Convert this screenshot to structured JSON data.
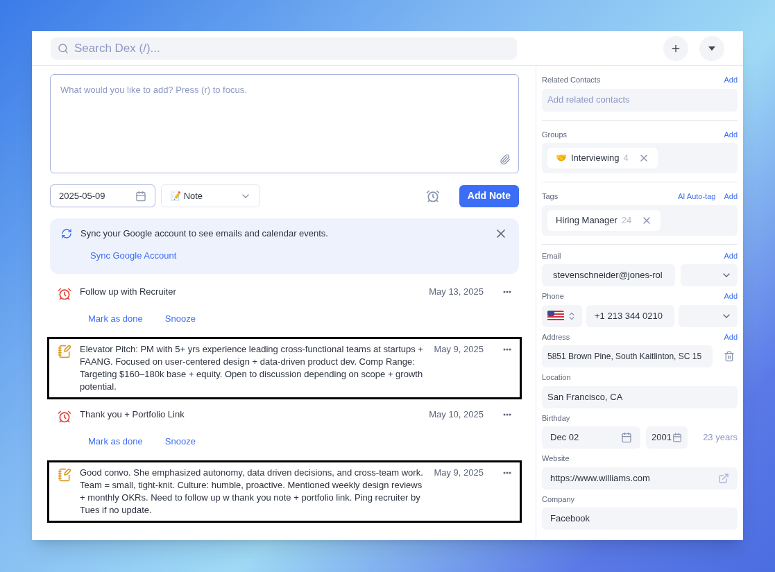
{
  "search": {
    "placeholder": "Search Dex (/)..."
  },
  "composer": {
    "placeholder": "What would you like to add? Press (r) to focus.",
    "date": "2025-05-09",
    "type_emoji": "📝",
    "type": "Note",
    "submit": "Add Note"
  },
  "sync_banner": {
    "message": "Sync your Google account to see emails and calendar events.",
    "action": "Sync Google Account"
  },
  "entries": [
    {
      "kind": "reminder",
      "text": "Follow up with Recruiter",
      "date": "May 13, 2025",
      "highlighted": false,
      "actions": [
        "Mark as done",
        "Snooze"
      ]
    },
    {
      "kind": "note",
      "text": "Elevator Pitch: PM with 5+ yrs experience leading cross-functional teams at startups + FAANG. Focused on user-centered design + data-driven product dev. Comp Range: Targeting $160–180k base + equity. Open to discussion depending on scope + growth potential.",
      "date": "May 9, 2025",
      "highlighted": true
    },
    {
      "kind": "reminder",
      "text": "Thank you + Portfolio Link",
      "date": "May 10, 2025",
      "highlighted": false,
      "actions": [
        "Mark as done",
        "Snooze"
      ]
    },
    {
      "kind": "note",
      "text": "Good convo. She emphasized autonomy, data driven decisions, and cross-team work. Team = small, tight-knit. Culture: humble, proactive. Mentioned weekly design reviews + monthly OKRs. Need to follow up w thank you note + portfolio link. Ping recruiter by Tues if no update.",
      "date": "May 9, 2025",
      "highlighted": true
    }
  ],
  "sidebar": {
    "related_contacts": {
      "label": "Related Contacts",
      "add": "Add",
      "placeholder": "Add related contacts"
    },
    "groups": {
      "label": "Groups",
      "add": "Add",
      "items": [
        {
          "emoji": "🤝",
          "name": "Interviewing",
          "count": "4"
        }
      ]
    },
    "tags": {
      "label": "Tags",
      "auto_tag": "AI Auto-tag",
      "add": "Add",
      "items": [
        {
          "name": "Hiring Manager",
          "count": "24"
        }
      ]
    },
    "email": {
      "label": "Email",
      "add": "Add",
      "value": "stevenschneider@jones-rol"
    },
    "phone": {
      "label": "Phone",
      "add": "Add",
      "value": "+1 213 344 0210"
    },
    "address": {
      "label": "Address",
      "add": "Add",
      "value": "5851 Brown Pine, South Kaitlinton, SC 15"
    },
    "location": {
      "label": "Location",
      "value": "San Francisco, CA"
    },
    "birthday": {
      "label": "Birthday",
      "date": "Dec 02",
      "year": "2001",
      "age": "23 years"
    },
    "website": {
      "label": "Website",
      "value": "https://www.williams.com"
    },
    "company": {
      "label": "Company",
      "value": "Facebook"
    }
  }
}
